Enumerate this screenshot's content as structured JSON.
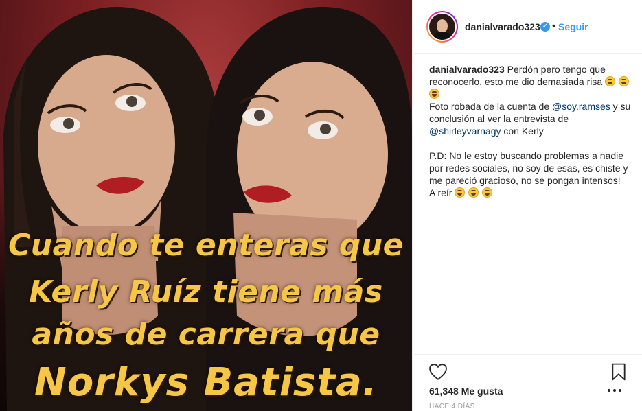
{
  "post": {
    "meme_lines": [
      "Cuando te enteras que",
      "Kerly Ruíz tiene más",
      "años de carrera que",
      "Norkys Batista."
    ]
  },
  "header": {
    "username": "danialvarado323",
    "verified_badge": "✓",
    "separator": "•",
    "follow_label": "Seguir",
    "avatar_icon": "profile-avatar"
  },
  "caption": {
    "username": "danialvarado323",
    "text1": "Perdón pero tengo que reconocerlo, esto me dio demasiada risa",
    "text2": "Foto robada de la cuenta de",
    "mention1": "@soy.ramses",
    "text3": "y su conclusión al ver la entrevista de",
    "mention2": "@shirleyvarnagy",
    "text4": "con Kerly",
    "text5": "P.D: No le estoy buscando problemas a nadie por redes sociales, no soy de esas, es chiste y me pareció gracioso, no se pongan intensos!",
    "text6": "A reír"
  },
  "actions": {
    "like_icon": "heart-outline",
    "save_icon": "bookmark-outline",
    "likes_label": "61,348 Me gusta",
    "more_icon": "more-horizontal",
    "timestamp": "HACE 4 DÍAS"
  },
  "colors": {
    "link": "#003569",
    "follow": "#3897f0",
    "meme_text": "#f6c646"
  }
}
